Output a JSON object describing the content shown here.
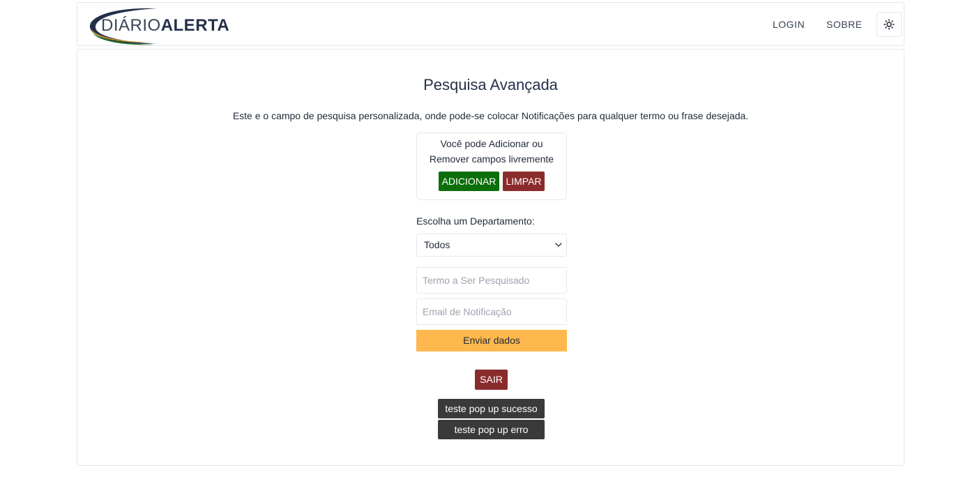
{
  "header": {
    "logo": {
      "part1": "DIÁRIO",
      "part2": "ALERTA"
    },
    "nav": {
      "login": "LOGIN",
      "sobre": "SOBRE"
    },
    "theme_icon": "sun-icon"
  },
  "main": {
    "title": "Pesquisa Avançada",
    "intro": "Este e o campo de pesquisa personalizada, onde pode-se colocar Notificações para qualquer termo ou frase desejada.",
    "fields_help_line1": "Você pode Adicionar ou",
    "fields_help_line2": "Remover campos livremente",
    "add_label": "ADICIONAR",
    "clear_label": "LIMPAR",
    "department_label": "Escolha um Departamento:",
    "department_selected": "Todos",
    "term_placeholder": "Termo a Ser Pesquisado",
    "email_placeholder": "Email de Notificação",
    "send_label": "Enviar dados",
    "exit_label": "SAIR",
    "test_success_label": "teste pop up sucesso",
    "test_error_label": "teste pop up erro"
  },
  "colors": {
    "add": "#0b6e0b",
    "clear": "#8b2c2c",
    "send": "#ffb84d",
    "exit": "#8b2c2c",
    "dark_button": "#3a3a3a",
    "logo_swoosh_dark": "#243049",
    "logo_swoosh_accent": "#d4a017"
  }
}
